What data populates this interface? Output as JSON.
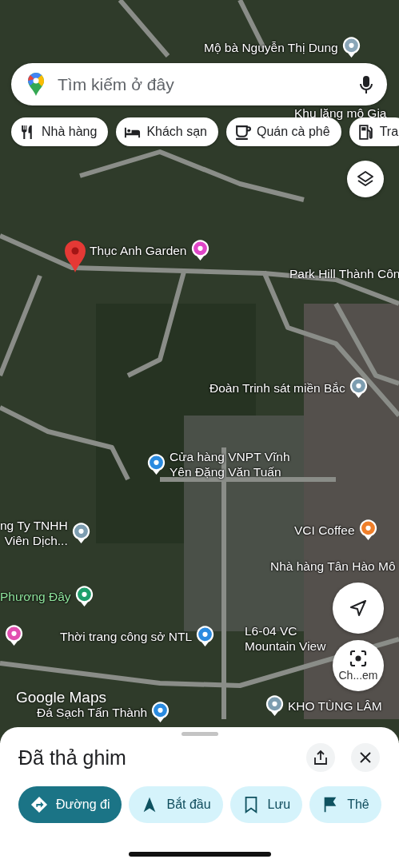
{
  "search": {
    "placeholder": "Tìm kiếm ở đây"
  },
  "chips": [
    {
      "label": "Nhà hàng",
      "kind": "restaurant"
    },
    {
      "label": "Khách sạn",
      "kind": "hotel"
    },
    {
      "label": "Quán cà phê",
      "kind": "cafe"
    },
    {
      "label": "Tra",
      "kind": "fuel"
    }
  ],
  "places": [
    {
      "lines": [
        "Mộ bà Nguyễn Thị Dung"
      ],
      "color": "#8aa6b8"
    },
    {
      "lines": [
        "Khu lăng mộ Gia"
      ]
    },
    {
      "lines": [
        "Thục Anh Garden"
      ],
      "color": "#e046c8"
    },
    {
      "lines": [
        "Park Hill Thành Côn"
      ]
    },
    {
      "lines": [
        "Đoàn Trinh sát miền Bắc"
      ],
      "color": "#7d9db0"
    },
    {
      "lines": [
        "Cửa hàng VNPT Vĩnh",
        "Yên Đặng Văn Tuấn"
      ],
      "color": "#2b8be0"
    },
    {
      "lines": [
        "ng Ty TNHH",
        "Viên Dịch..."
      ],
      "color": "#7d9db0"
    },
    {
      "lines": [
        "VCI Coffee"
      ],
      "color": "#f07f2a"
    },
    {
      "lines": [
        "Nhà hàng Tân Hào Mô"
      ]
    },
    {
      "lines": [
        "Phương Đây"
      ],
      "color": "#1f9e6c"
    },
    {
      "color": "#e24fb0"
    },
    {
      "lines": [
        "Thời trang công sở NTL"
      ],
      "color": "#2b8be0"
    },
    {
      "lines": [
        "L6-04 VC",
        "Mountain View"
      ]
    },
    {
      "lines": [
        "KHO TÙNG LÂM"
      ],
      "color": "#7d9db0"
    },
    {
      "lines": [
        "Đá Sạch Tấn Thành"
      ],
      "color": "#2b8be0"
    }
  ],
  "map_logo": "Google Maps",
  "lens_button": {
    "label": "Ch...em"
  },
  "sheet": {
    "title": "Đã thả ghim",
    "actions": [
      {
        "label": "Đường đi",
        "kind": "primary"
      },
      {
        "label": "Bắt đầu",
        "kind": "start"
      },
      {
        "label": "Lưu",
        "kind": "save"
      },
      {
        "label": "Thê",
        "kind": "flag"
      }
    ]
  }
}
